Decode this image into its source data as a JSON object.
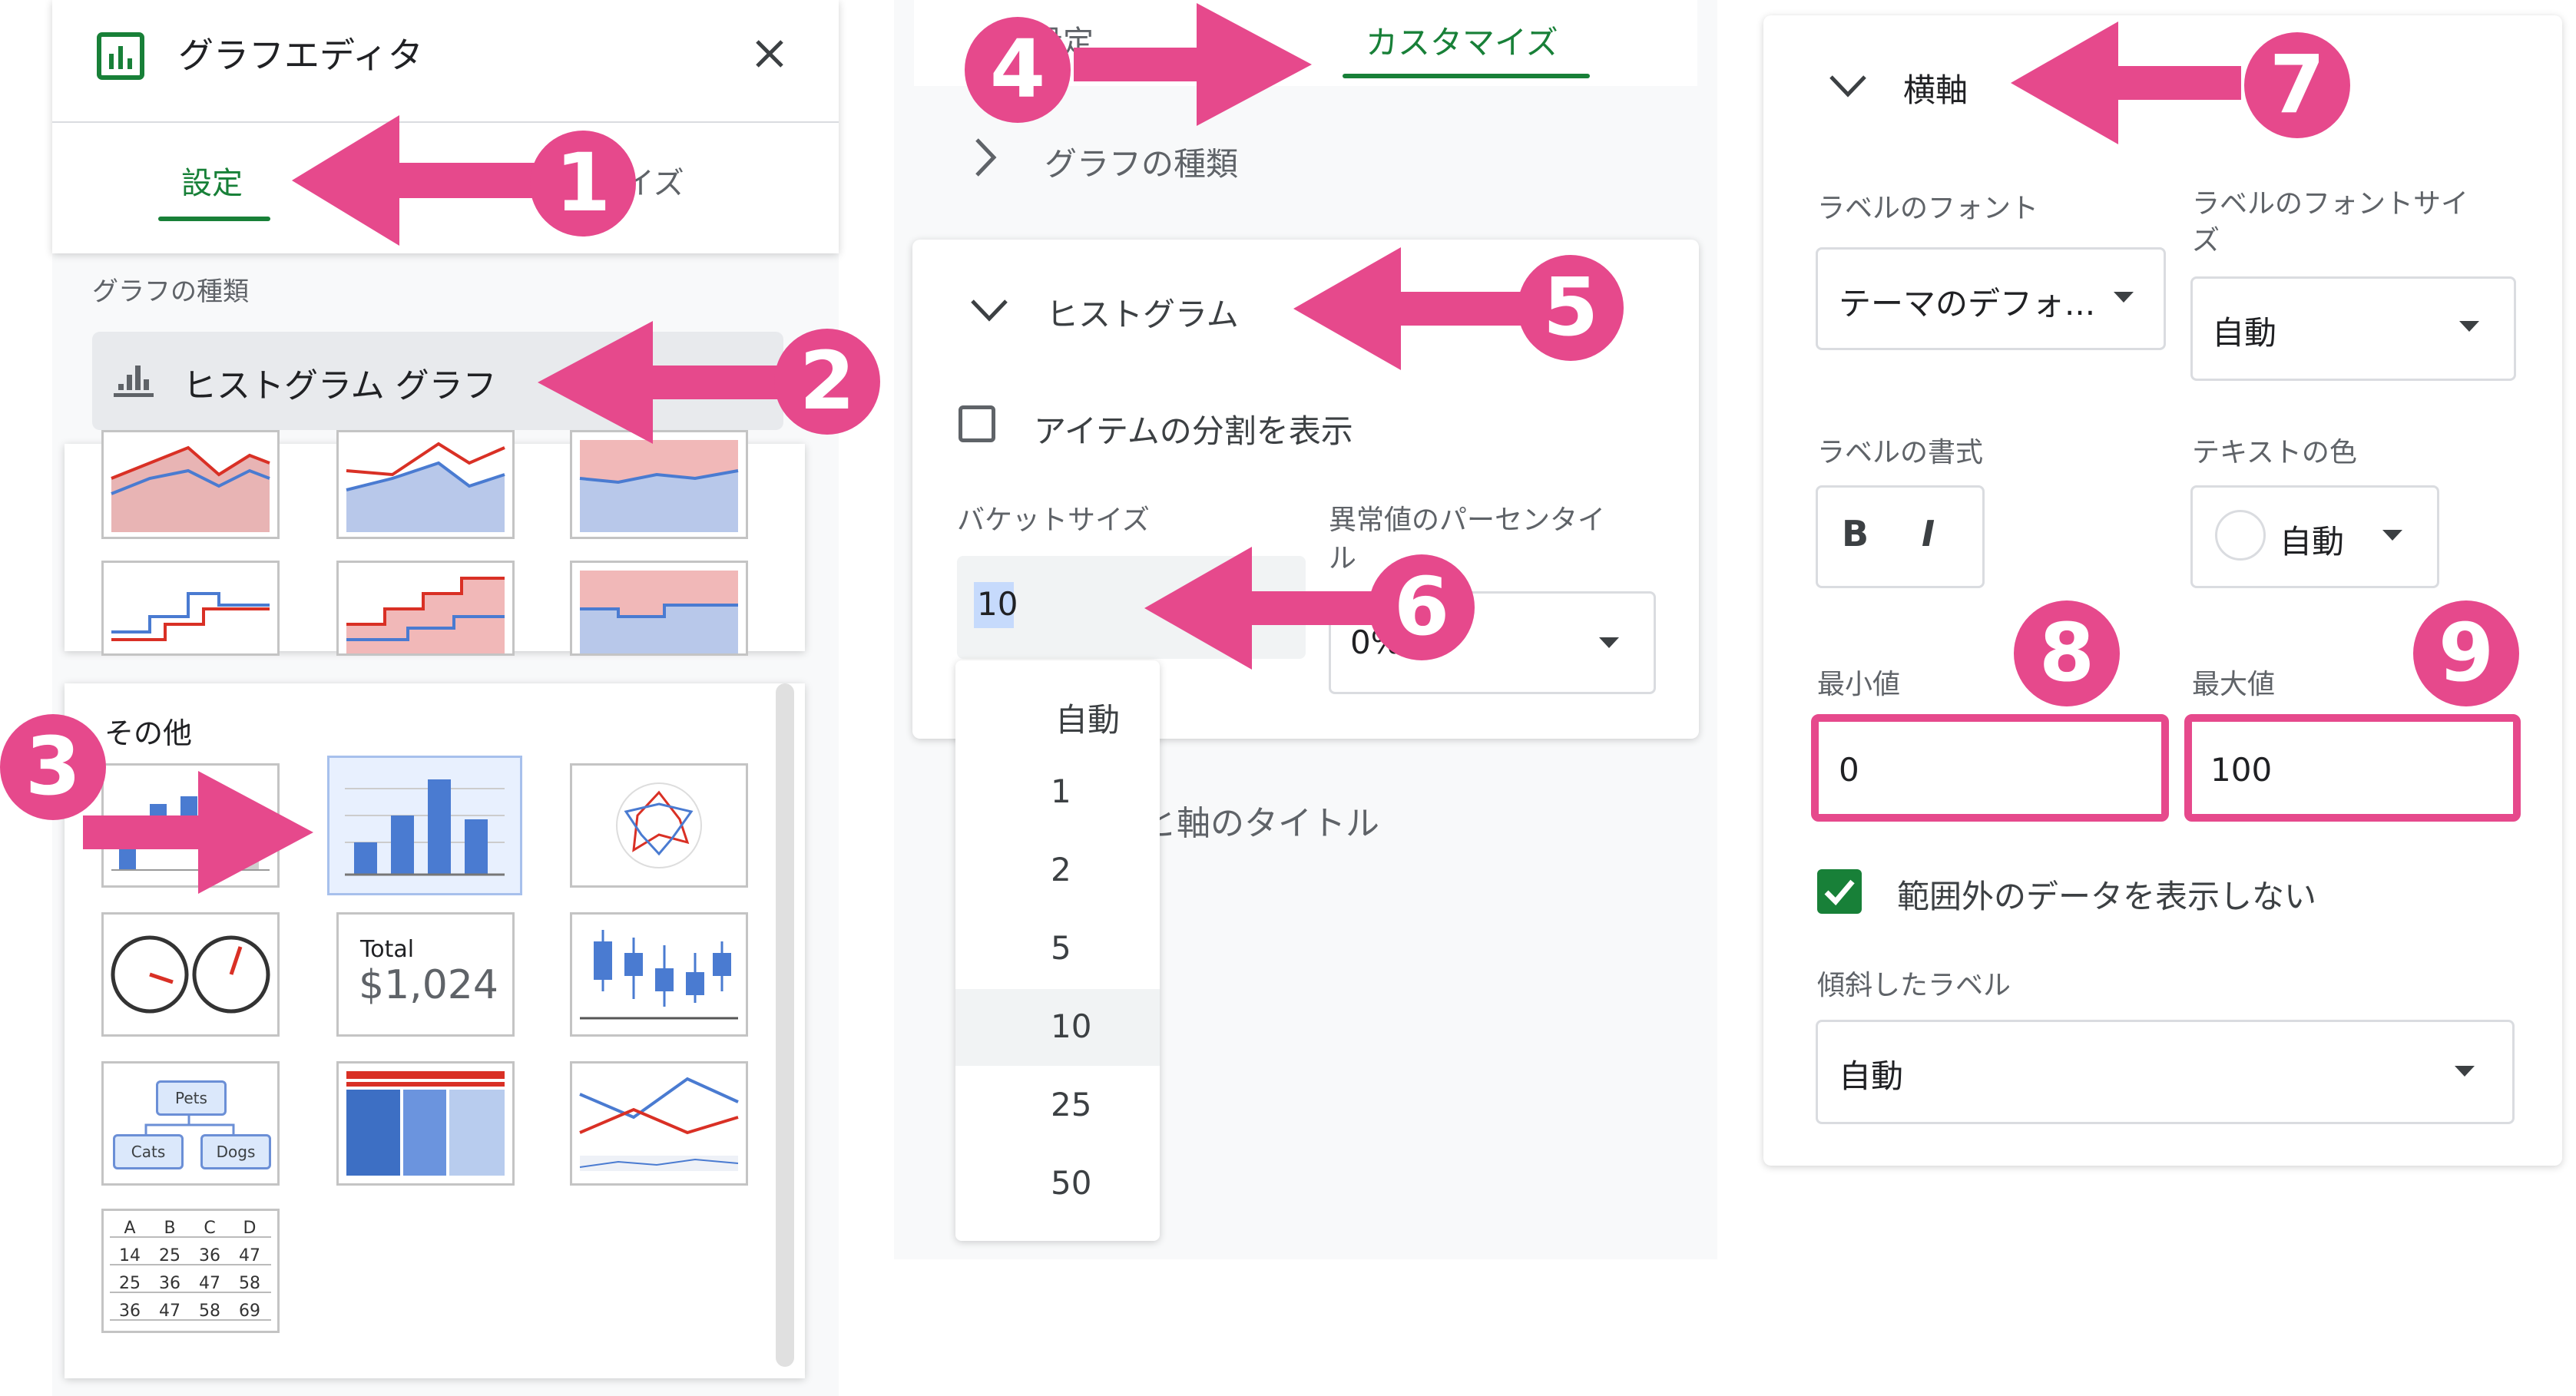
{
  "left_panel": {
    "title": "グラフエディタ",
    "close_icon": "close-icon",
    "title_icon": "chart-icon",
    "tab_setup": "設定",
    "tab_customize": "カスタマイズ",
    "chart_type_label": "グラフの種類",
    "chart_type_value": "ヒストグラム グラフ",
    "other_label": "その他",
    "scorecard_total": "Total",
    "scorecard_value": "$1,024",
    "org_root": "Pets",
    "org_left": "Cats",
    "org_right": "Dogs",
    "table_header": [
      "A",
      "B",
      "C",
      "D"
    ],
    "table_rows": [
      [
        "14",
        "25",
        "36",
        "47"
      ],
      [
        "25",
        "36",
        "47",
        "58"
      ],
      [
        "36",
        "47",
        "58",
        "69"
      ]
    ]
  },
  "middle_panel": {
    "tab_setup": "設定",
    "tab_customize": "カスタマイズ",
    "section_chart_type": "グラフの種類",
    "section_histogram": "ヒストグラム",
    "show_item_dividers": "アイテムの分割を表示",
    "bucket_size_label": "バケットサイズ",
    "bucket_size_value": "10",
    "outlier_label_1": "異常値のパーセンタイ",
    "outlier_label_2": "ル",
    "outlier_value": "0%",
    "axis_titles_partial": "と軸のタイトル",
    "bucket_options": [
      "自動",
      "1",
      "2",
      "5",
      "10",
      "25",
      "50"
    ],
    "selected_option": "10"
  },
  "right_panel": {
    "section_title": "横軸",
    "label_font": "ラベルのフォント",
    "label_font_value": "テーマのデフォ...",
    "label_font_size_1": "ラベルのフォントサイ",
    "label_font_size_2": "ズ",
    "label_font_size_value": "自動",
    "label_format": "ラベルの書式",
    "bold": "B",
    "italic": "I",
    "text_color": "テキストの色",
    "text_color_value": "自動",
    "min_label": "最小値",
    "min_value": "0",
    "max_label": "最大値",
    "max_value": "100",
    "hide_out_of_range": "範囲外のデータを表示しない",
    "slanted_labels": "傾斜したラベル",
    "slanted_value": "自動"
  },
  "annotations": {
    "numbers": [
      "1",
      "2",
      "3",
      "4",
      "5",
      "6",
      "7",
      "8",
      "9"
    ],
    "color": "#e6498c"
  },
  "colors": {
    "accent_green": "#188038",
    "highlight_pink": "#e6498c",
    "checkbox_green": "#188038"
  }
}
